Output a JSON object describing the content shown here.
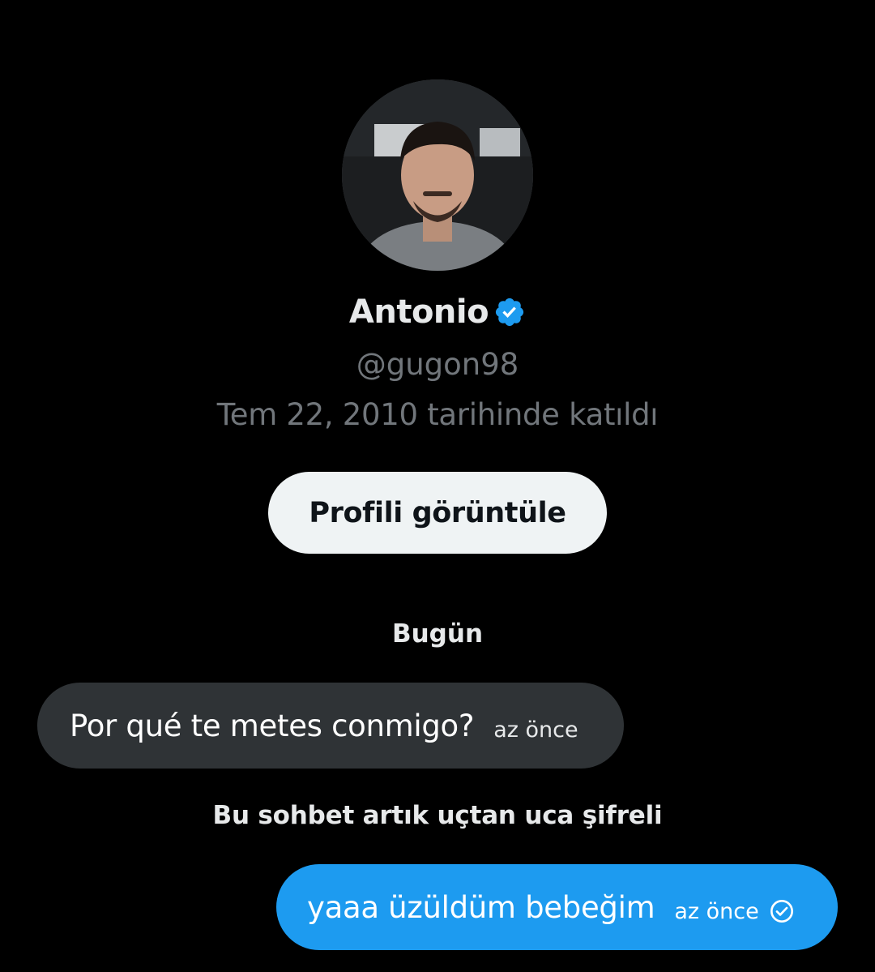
{
  "profile": {
    "name": "Antonio",
    "verified_icon": "verified-badge-icon",
    "handle": "@gugon98",
    "joined": "Tem 22, 2010 tarihinde katıldı",
    "view_profile_label": "Profili görüntüle"
  },
  "conversation": {
    "day_separator": "Bugün",
    "encryption_notice": "Bu sohbet artık uçtan uca şifreli",
    "messages": [
      {
        "direction": "incoming",
        "text": "Por qué te metes conmigo?",
        "time": "az önce"
      },
      {
        "direction": "outgoing",
        "text": "yaaa üzüldüm bebeğim",
        "time": "az önce",
        "status_icon": "read-check-icon"
      }
    ]
  },
  "colors": {
    "background": "#000000",
    "primary_text": "#e7e9ea",
    "secondary_text": "#71767b",
    "incoming_bubble": "#2f3336",
    "outgoing_bubble": "#1d9bf0",
    "verified": "#1d9bf0",
    "button_bg": "#eff3f4"
  }
}
